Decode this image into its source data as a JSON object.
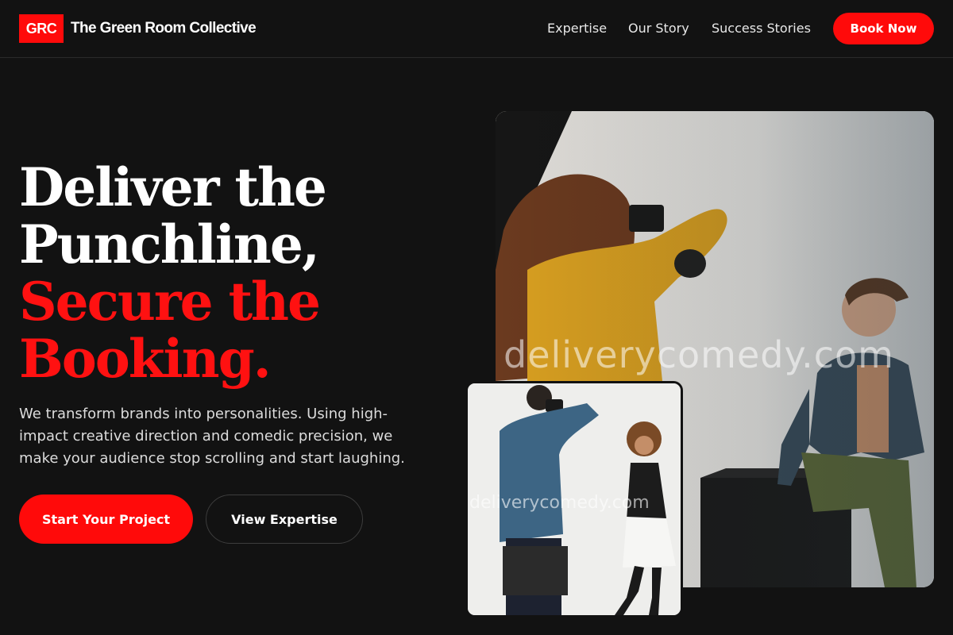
{
  "header": {
    "logo_badge": "GRC",
    "brand_name": "The Green Room Collective",
    "nav": [
      {
        "label": "Expertise"
      },
      {
        "label": "Our Story"
      },
      {
        "label": "Success Stories"
      }
    ],
    "cta_label": "Book Now"
  },
  "hero": {
    "title_lines": [
      "Deliver the",
      "Punchline,"
    ],
    "accent_lines": [
      "Secure the",
      "Booking."
    ],
    "description": "We transform brands into personalities. Using high-impact creative direction and comedic precision, we make your audience stop scrolling and start laughing.",
    "primary_cta": "Start Your Project",
    "secondary_cta": "View Expertise"
  },
  "images": {
    "main_watermark": "deliverycomedy.com",
    "secondary_watermark": "deliverycomedy.com"
  },
  "colors": {
    "background": "#121212",
    "accent": "#ff0a0a",
    "text": "#ffffff",
    "muted_text": "#dcdcdc"
  }
}
